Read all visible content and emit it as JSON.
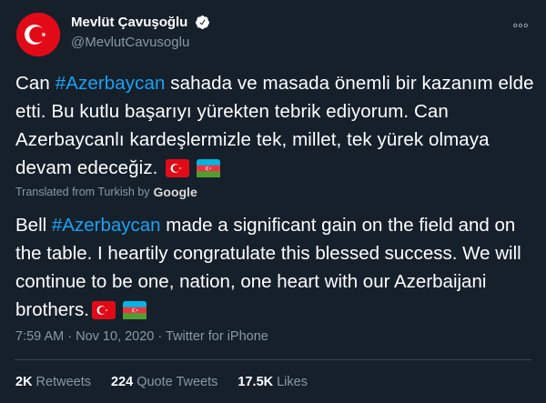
{
  "author": {
    "display_name": "Mevlüt Çavuşoğlu",
    "handle": "@MevlutCavusoglu",
    "avatar_icon": "turkish-flag-avatar",
    "verified_icon": "verified-badge-icon"
  },
  "tweet": {
    "segments": [
      {
        "text": "Can "
      },
      {
        "text": "#Azerbaycan",
        "hashtag": true
      },
      {
        "text": " sahada ve masada önemli bir kazanım elde etti. Bu kutlu başarıyı yürekten tebrik ediyorum. Can Azerbaycanlı kardeşlermizle tek, millet, tek yürek olmaya devam edeceğiz. "
      }
    ],
    "flags": [
      "turkey-flag-icon",
      "azerbaijan-flag-icon"
    ]
  },
  "translation": {
    "label": "Translated from Turkish by",
    "provider": "Google",
    "segments": [
      {
        "text": "Bell "
      },
      {
        "text": "#Azerbaycan",
        "hashtag": true
      },
      {
        "text": " made a significant gain on the field and on the table. I heartily congratulate this blessed success. We will continue to be one, nation, one heart with our Azerbaijani brothers."
      }
    ]
  },
  "meta": {
    "time": "7:59 AM",
    "separator": "·",
    "date": "Nov 10, 2020",
    "source": "Twitter for iPhone"
  },
  "stats": [
    {
      "count": "2K",
      "label": "Retweets"
    },
    {
      "count": "224",
      "label": "Quote Tweets"
    },
    {
      "count": "17.5K",
      "label": "Likes"
    }
  ],
  "colors": {
    "background": "#15202b",
    "hashtag": "#1da1f2",
    "secondary_text": "#8899a6",
    "divider": "#38444d",
    "turkey_red": "#e30a17"
  }
}
